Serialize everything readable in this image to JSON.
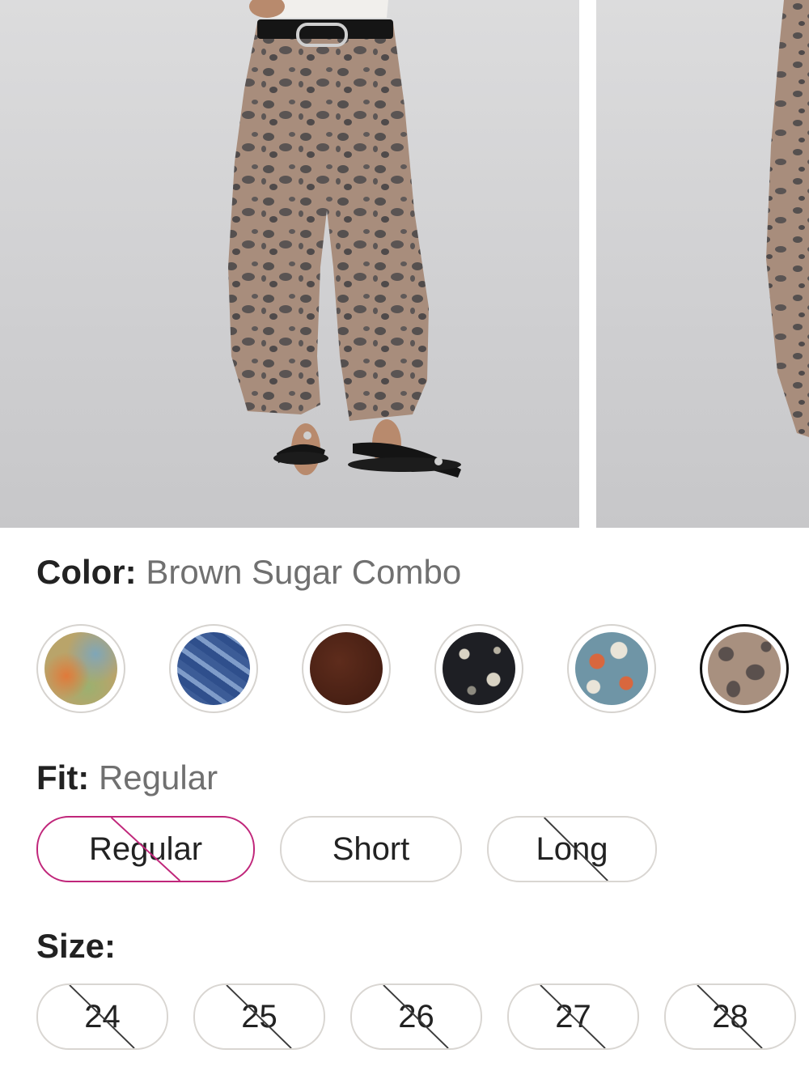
{
  "product": {
    "color": {
      "key": "Color:",
      "value": "Brown Sugar Combo"
    },
    "fit": {
      "key": "Fit:",
      "value": "Regular"
    },
    "size": {
      "key": "Size:"
    }
  },
  "swatches": [
    {
      "name": "multicolor-tie-dye",
      "selected": false
    },
    {
      "name": "blue-zebra",
      "selected": false
    },
    {
      "name": "dark-brown",
      "selected": false
    },
    {
      "name": "black-paisley",
      "selected": false
    },
    {
      "name": "blue-floral-print",
      "selected": false
    },
    {
      "name": "brown-leopard",
      "selected": true
    }
  ],
  "fit_options": [
    {
      "label": "Regular",
      "selected": true,
      "unavailable": true
    },
    {
      "label": "Short",
      "selected": false,
      "unavailable": false
    },
    {
      "label": "Long",
      "selected": false,
      "unavailable": true
    }
  ],
  "size_options": [
    {
      "label": "24",
      "unavailable": true
    },
    {
      "label": "25",
      "unavailable": true
    },
    {
      "label": "26",
      "unavailable": true
    },
    {
      "label": "27",
      "unavailable": true
    },
    {
      "label": "28",
      "unavailable": true
    }
  ],
  "colors": {
    "accent_selected_fit": "#c0267a",
    "label_value": "#707070",
    "pill_border": "#d9d6d2"
  }
}
